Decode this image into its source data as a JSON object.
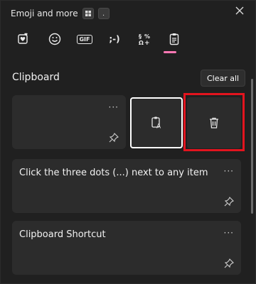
{
  "window": {
    "title": "Emoji and more",
    "key_windows_icon": "windows-key-icon",
    "key_period": "."
  },
  "tabs": [
    {
      "name": "favorites",
      "icon": "heart-icon"
    },
    {
      "name": "emoji",
      "icon": "smiley-icon"
    },
    {
      "name": "gif",
      "label": "GIF"
    },
    {
      "name": "kaomoji",
      "label": ";-)"
    },
    {
      "name": "symbols",
      "icon": "symbols-icon"
    },
    {
      "name": "clipboard",
      "icon": "clipboard-icon",
      "selected": true
    }
  ],
  "clipboard": {
    "title": "Clipboard",
    "clear_all": "Clear all",
    "items": [
      {
        "text": "",
        "more": "···"
      },
      {
        "text": "Click the three dots (...) next to any item",
        "more": "···"
      },
      {
        "text": "Clipboard Shortcut",
        "more": "···"
      }
    ]
  },
  "colors": {
    "accent": "#ff78b4",
    "highlight": "#e3141e",
    "background": "#202020",
    "card": "#2c2c2c"
  }
}
